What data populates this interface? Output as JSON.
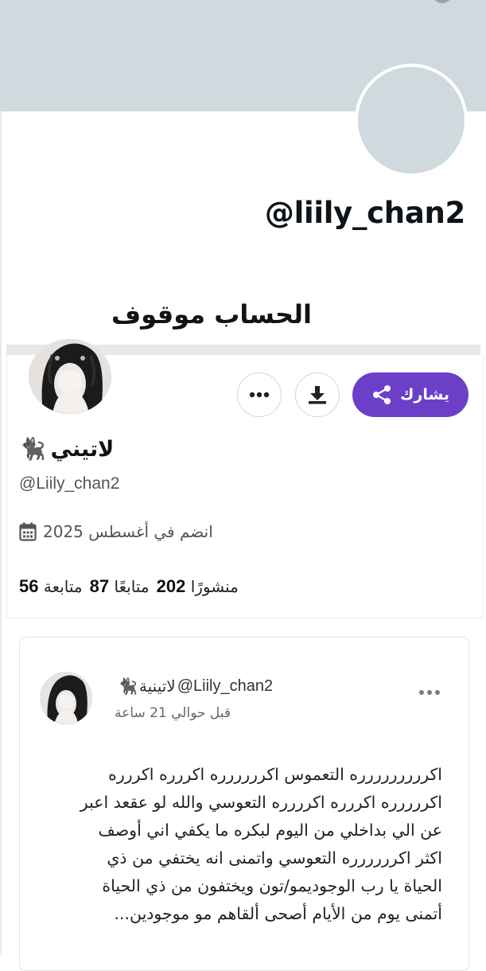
{
  "suspended_header": {
    "handle": "@liily_chan2",
    "status_text": "الحساب موقوف"
  },
  "profile": {
    "display_name": "لاتيني",
    "name_emoji": "🐈‍⬛",
    "handle": "@Liily_chan2",
    "joined_text": "انضم في أغسطس 2025",
    "stats": {
      "posts_count": "202",
      "posts_label": "منشورًا",
      "followers_count": "87",
      "followers_label": "متابعًا",
      "following_count": "56",
      "following_label": "متابعة"
    },
    "share_label": "يشارك",
    "icons": {
      "share": "share-icon",
      "download": "download-icon",
      "more": "more-horizontal-icon",
      "calendar": "calendar-icon"
    },
    "colors": {
      "accent": "#6c3fc9",
      "banner": "#cfd9de"
    }
  },
  "post": {
    "author_name": "لاتينية",
    "author_emoji": "🐈‍⬛",
    "author_handle": "@Liily_chan2",
    "time": "قبل حوالي 21 ساعة",
    "lines": [
      "اكررررررررره التعموس اكرررررره اكررره اكررره",
      "اكررررره اكررره اكرررره التعوسي والله لو عقعد اعبر",
      "عن الي بداخلي من اليوم لبكره ما يكفي اني أوصف",
      "اكثر اكرررررره التعوسي واتمنى انه يختفي من ذي",
      "الحياة يا رب الوجوديمو/تون ويختفون من ذي الحياة",
      "أتمنى يوم من الأيام أصحى ألقاهم مو موجودين..."
    ]
  }
}
